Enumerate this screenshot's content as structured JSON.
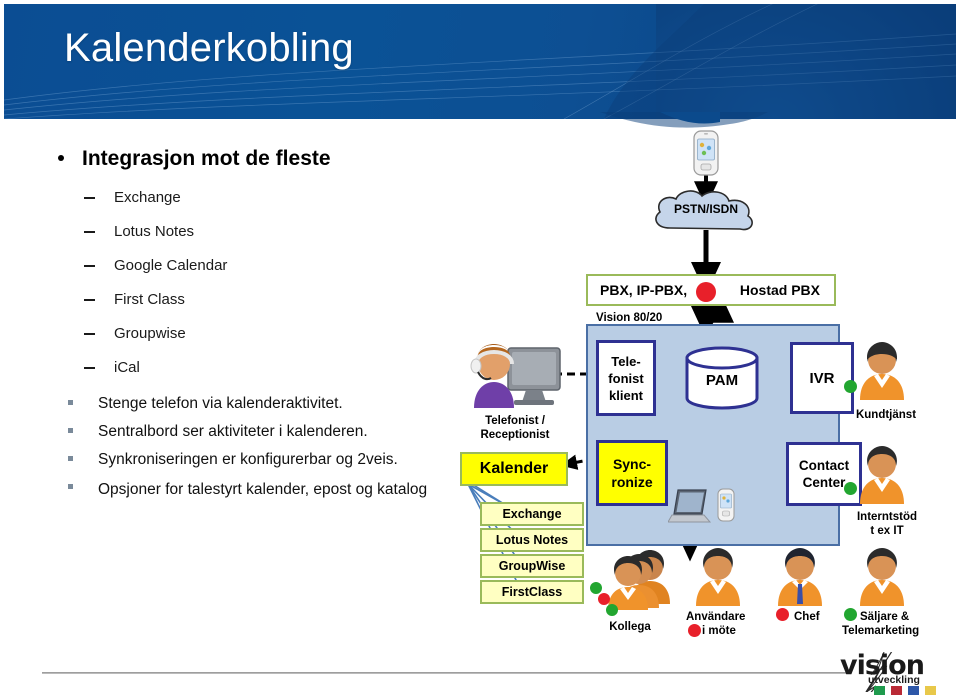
{
  "slide": {
    "title": "Kalenderkobling"
  },
  "bullets": {
    "main": "Integrasjon mot de fleste",
    "sub_items": [
      "Exchange",
      "Lotus Notes",
      "Google Calendar",
      "First Class",
      "Groupwise",
      "iCal"
    ],
    "points": [
      "Stenge telefon via kalenderaktivitet.",
      "Sentralbord ser aktiviteter i kalenderen.",
      "Synkroniseringen er konfigurerbar og 2veis.",
      "Opsjoner for talestyrt kalender, epost og katalog"
    ]
  },
  "diagram": {
    "cloud_label": "PSTN/ISDN",
    "pbx_label_left": "PBX, IP-PBX,",
    "pbx_label_right": "Hostad  PBX",
    "vision_container": "Vision 80/20",
    "telefonist_klient": "Tele-\nfonist\nklient",
    "telefonist_klient_lines": [
      "Tele-",
      "fonist",
      "klient"
    ],
    "pam": "PAM",
    "ivr": "IVR",
    "synchronize_lines": [
      "Sync-",
      "ronize"
    ],
    "contact_center_lines": [
      "Contact",
      "Center"
    ],
    "operator_label_lines": [
      "Telefonist /",
      "Receptionist"
    ],
    "calendar_main": "Kalender",
    "calendar_systems": [
      "Exchange",
      "Lotus Notes",
      "GroupWise",
      "FirstClass"
    ],
    "people": [
      {
        "name": "kundtjanst",
        "label_lines": [
          "Kundtjänst"
        ],
        "dot_color": "#22a630"
      },
      {
        "name": "interntstod",
        "label_lines": [
          "Interntstöd",
          "t ex IT"
        ],
        "dot_color": "#22a630"
      },
      {
        "name": "kollega",
        "label_lines": [
          "Kollega"
        ],
        "dot_color": "#22a630"
      },
      {
        "name": "anvandare-i-mote",
        "label_lines": [
          "Användare",
          "i möte"
        ],
        "dot_color": "#e8202a"
      },
      {
        "name": "chef",
        "label_lines": [
          "Chef"
        ],
        "dot_color": "#e8202a"
      },
      {
        "name": "saljare",
        "label_lines": [
          "Säljare &",
          "Telemarketing"
        ],
        "dot_color": "#22a630"
      }
    ]
  },
  "logo": {
    "word": "vision",
    "sub": "utveckling",
    "square_colors": [
      "#1f9a4d",
      "#b92a36",
      "#2d57a8",
      "#e8c84a"
    ]
  },
  "colors": {
    "banner_blue": "#0a5296",
    "cloud_blue": "#c5d5ea",
    "vision_panel": "#b9cde4",
    "navy_border": "#2e3192",
    "green_border": "#8fbc54",
    "yellow_fill": "#ffff00",
    "red_dot": "#e8202a",
    "green_dot": "#22a630"
  }
}
